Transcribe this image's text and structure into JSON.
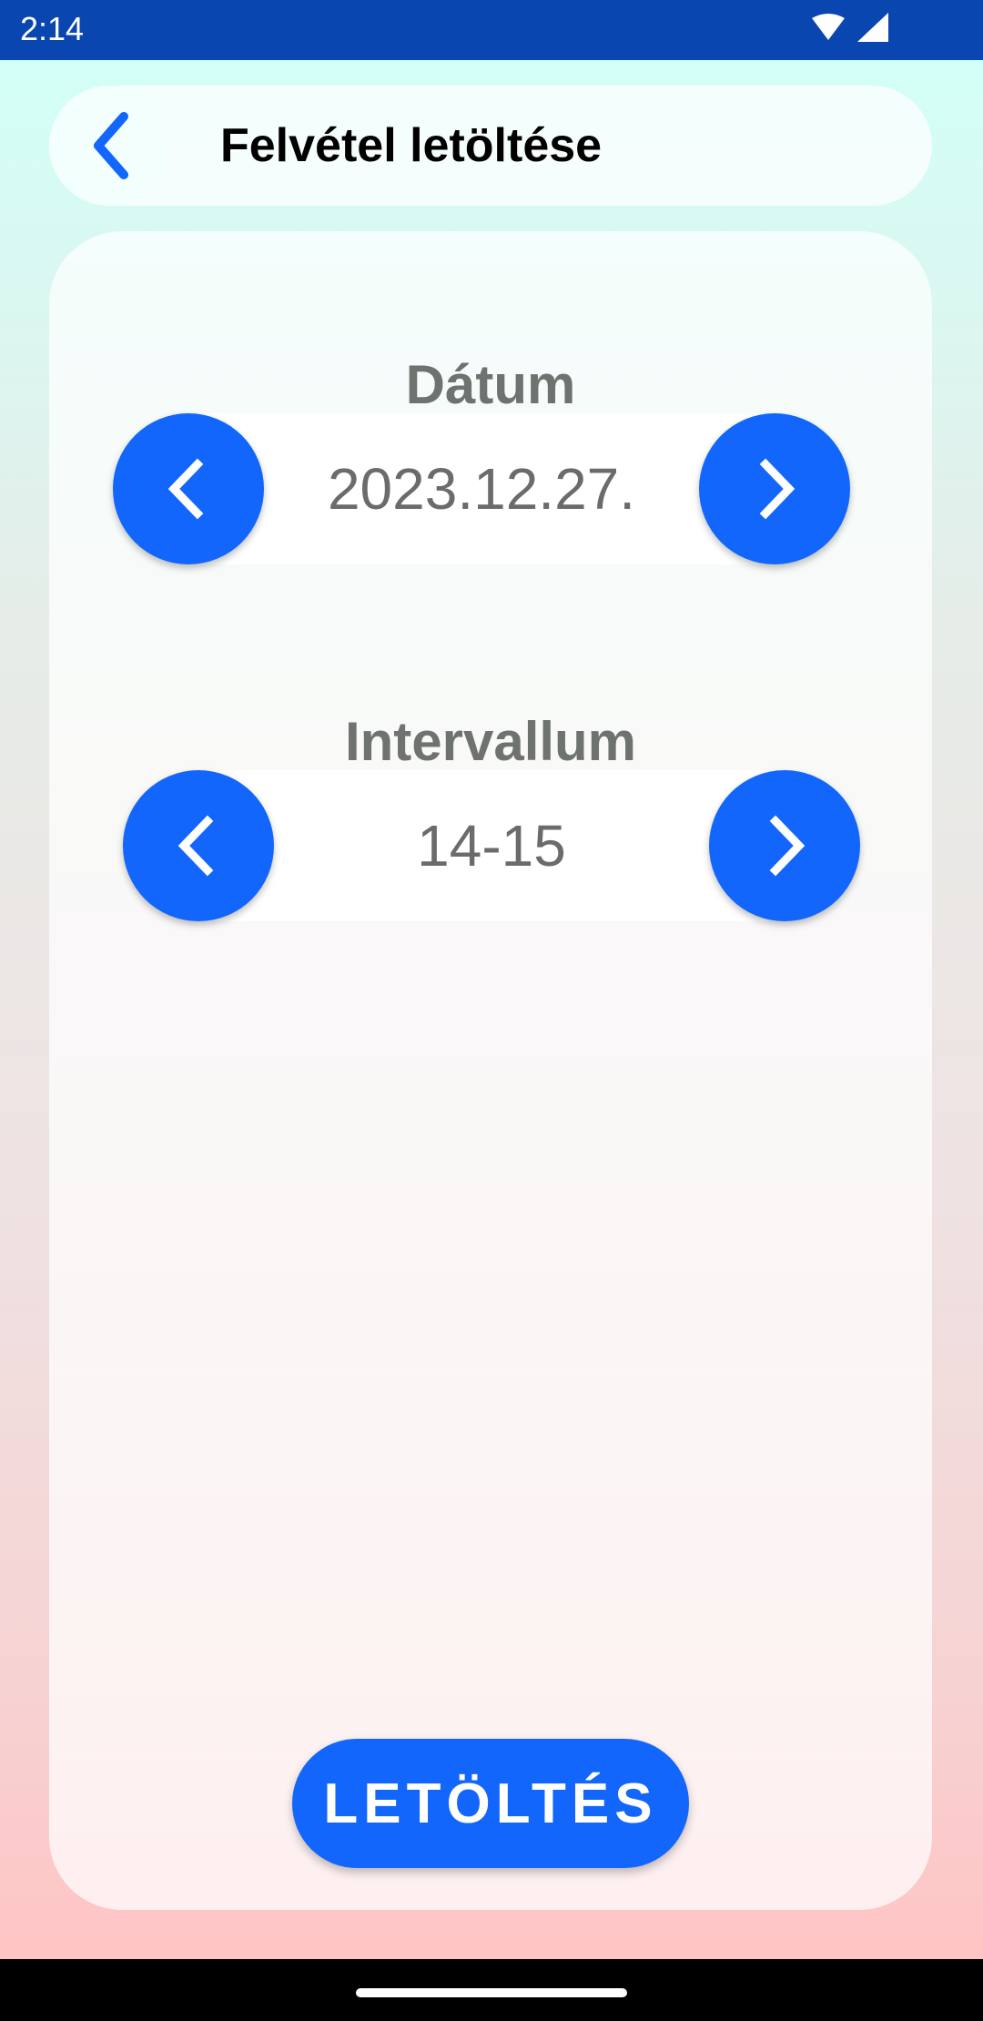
{
  "status_bar": {
    "time": "2:14",
    "icons": [
      "wifi-icon",
      "signal-icon"
    ]
  },
  "header": {
    "title": "Felvétel letöltése",
    "back_icon": "chevron-left-icon"
  },
  "date_section": {
    "label": "Dátum",
    "value": "2023.12.27."
  },
  "interval_section": {
    "label": "Intervallum",
    "value": "14-15"
  },
  "download_button": {
    "label": "LETÖLTÉS"
  },
  "colors": {
    "accent": "#1266fb",
    "status_bar": "#0a46b0",
    "label_text": "#6f7370"
  }
}
